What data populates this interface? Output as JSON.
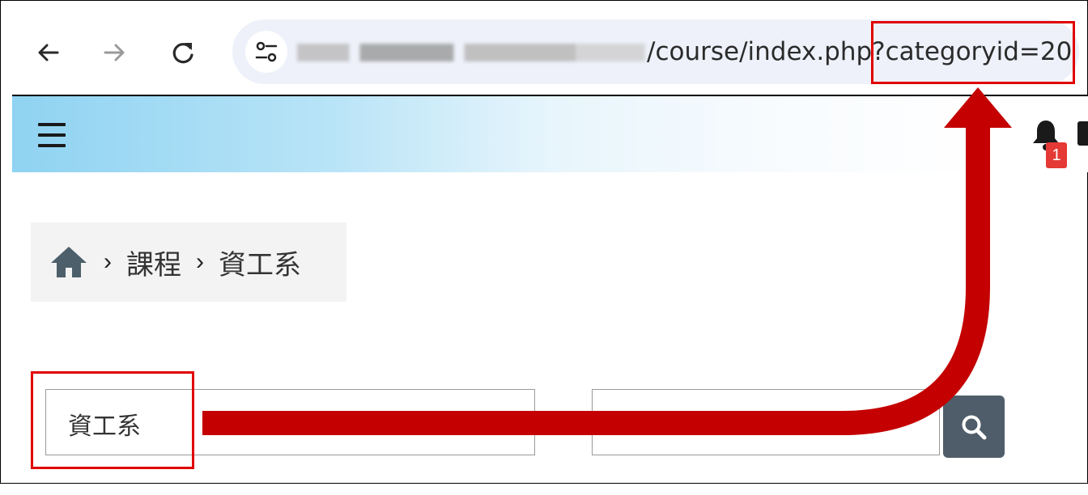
{
  "browser": {
    "url_visible": "/course/index.php?categoryid=20",
    "nav_icons": [
      "back-icon",
      "forward-icon",
      "reload-icon",
      "site-settings-icon"
    ]
  },
  "header": {
    "menu_icon": "hamburger-icon",
    "notification_count": "1"
  },
  "breadcrumb": {
    "items": [
      "課程",
      "資工系"
    ]
  },
  "filter": {
    "category_value": "資工系",
    "search_placeholder": ""
  },
  "annotation": {
    "highlight_color": "#e00000",
    "arrow_color": "#c40000"
  }
}
